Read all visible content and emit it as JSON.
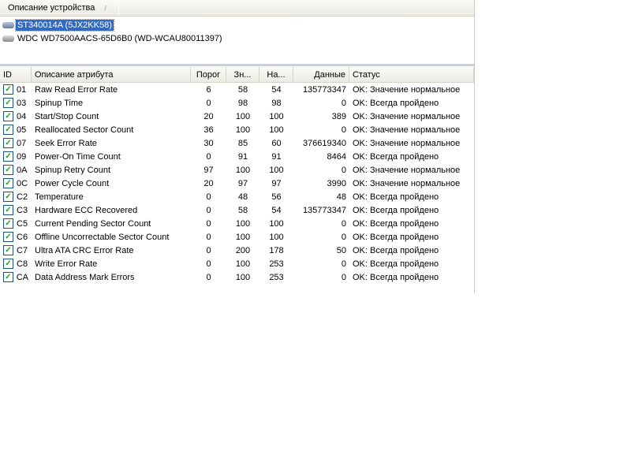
{
  "header": {
    "device_col": "Описание устройства",
    "sort_indicator": "/"
  },
  "devices": [
    {
      "name": "ST340014A (5JX2KK58)",
      "selected": true
    },
    {
      "name": "WDC WD7500AACS-65D6B0 (WD-WCAU80011397)",
      "selected": false
    }
  ],
  "columns": [
    "ID",
    "Описание атрибута",
    "Порог",
    "Зн...",
    "На...",
    "Данные",
    "Статус"
  ],
  "rows": [
    [
      "01",
      "Raw Read Error Rate",
      "6",
      "58",
      "54",
      "135773347",
      "OK: Значение нормальное"
    ],
    [
      "03",
      "Spinup Time",
      "0",
      "98",
      "98",
      "0",
      "OK: Всегда пройдено"
    ],
    [
      "04",
      "Start/Stop Count",
      "20",
      "100",
      "100",
      "389",
      "OK: Значение нормальное"
    ],
    [
      "05",
      "Reallocated Sector Count",
      "36",
      "100",
      "100",
      "0",
      "OK: Значение нормальное"
    ],
    [
      "07",
      "Seek Error Rate",
      "30",
      "85",
      "60",
      "376619340",
      "OK: Значение нормальное"
    ],
    [
      "09",
      "Power-On Time Count",
      "0",
      "91",
      "91",
      "8464",
      "OK: Всегда пройдено"
    ],
    [
      "0A",
      "Spinup Retry Count",
      "97",
      "100",
      "100",
      "0",
      "OK: Значение нормальное"
    ],
    [
      "0C",
      "Power Cycle Count",
      "20",
      "97",
      "97",
      "3990",
      "OK: Значение нормальное"
    ],
    [
      "C2",
      "Temperature",
      "0",
      "48",
      "56",
      "48",
      "OK: Всегда пройдено"
    ],
    [
      "C3",
      "Hardware ECC Recovered",
      "0",
      "58",
      "54",
      "135773347",
      "OK: Всегда пройдено"
    ],
    [
      "C5",
      "Current Pending Sector Count",
      "0",
      "100",
      "100",
      "0",
      "OK: Всегда пройдено"
    ],
    [
      "C6",
      "Offline Uncorrectable Sector Count",
      "0",
      "100",
      "100",
      "0",
      "OK: Всегда пройдено"
    ],
    [
      "C7",
      "Ultra ATA CRC Error Rate",
      "0",
      "200",
      "178",
      "50",
      "OK: Всегда пройдено"
    ],
    [
      "C8",
      "Write Error Rate",
      "0",
      "100",
      "253",
      "0",
      "OK: Всегда пройдено"
    ],
    [
      "CA",
      "Data Address Mark Errors",
      "0",
      "100",
      "253",
      "0",
      "OK: Всегда пройдено"
    ]
  ]
}
